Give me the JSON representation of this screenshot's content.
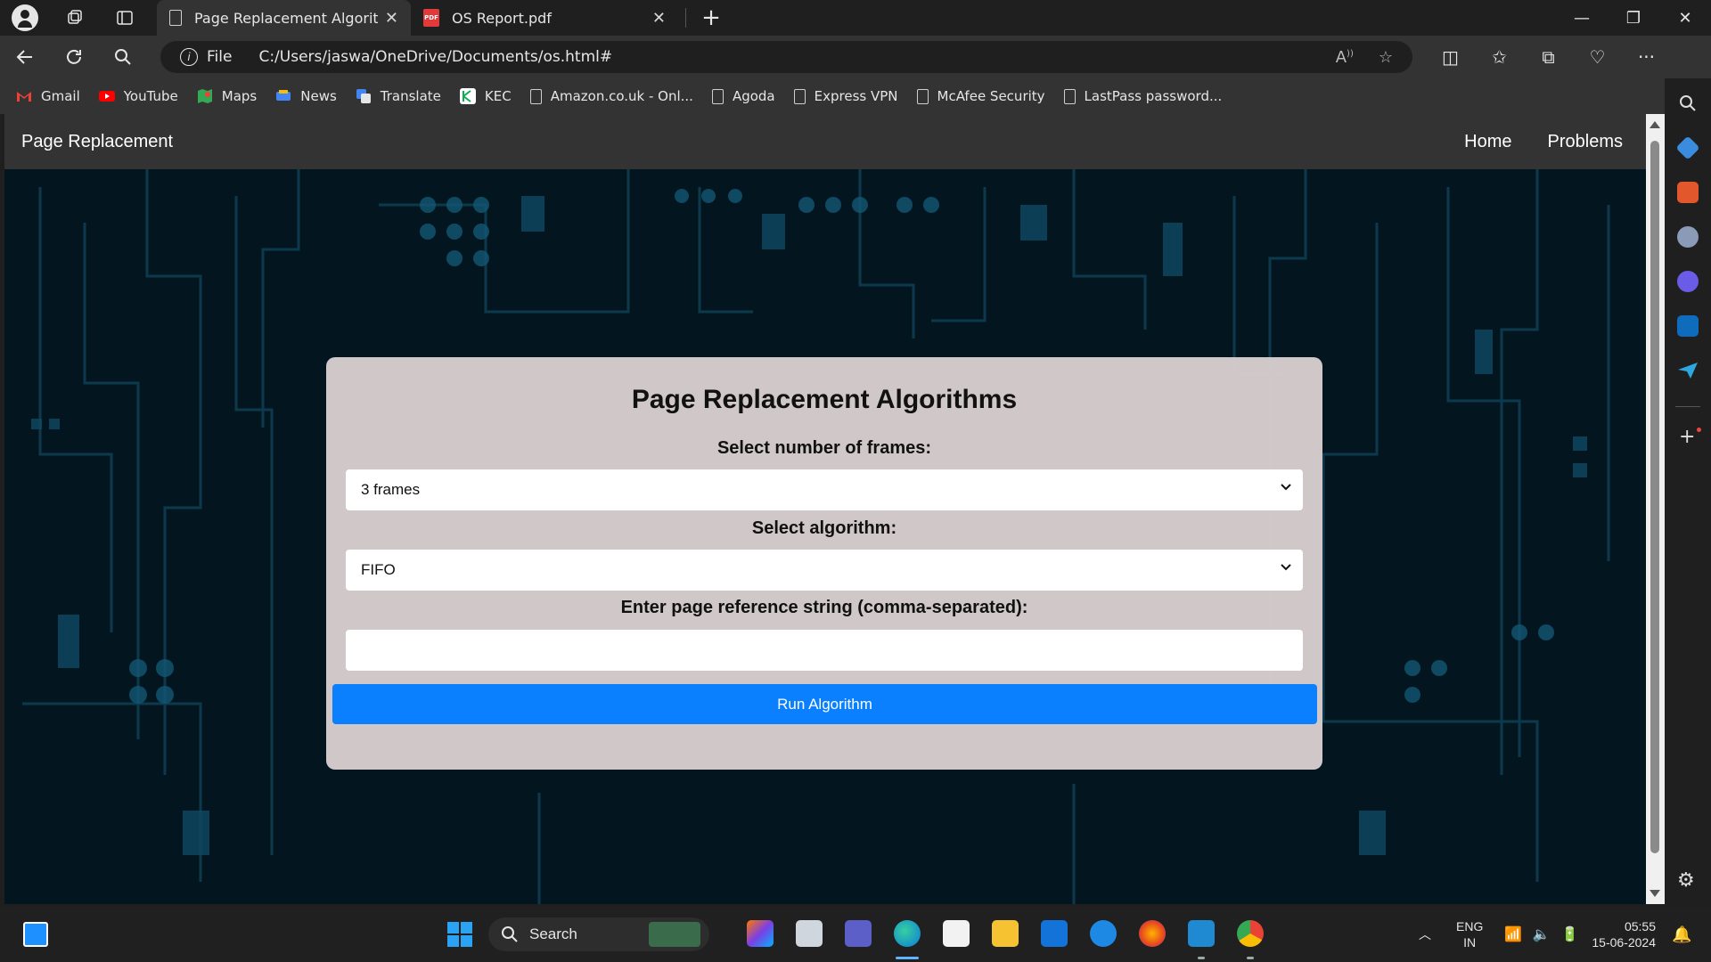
{
  "browser": {
    "tabs": [
      {
        "title": "Page Replacement Algorithms",
        "active": true
      },
      {
        "title": "OS Report.pdf",
        "active": false
      }
    ],
    "address": {
      "scheme_label": "File",
      "url": "C:/Users/jaswa/OneDrive/Documents/os.html#"
    },
    "bookmarks": [
      {
        "label": "Gmail",
        "icon": "gmail-icon",
        "color": "#ea4335"
      },
      {
        "label": "YouTube",
        "icon": "youtube-icon",
        "color": "#ff0000"
      },
      {
        "label": "Maps",
        "icon": "maps-icon",
        "color": "#34a853"
      },
      {
        "label": "News",
        "icon": "news-icon",
        "color": "#4285f4"
      },
      {
        "label": "Translate",
        "icon": "translate-icon",
        "color": "#4285f4"
      },
      {
        "label": "KEC",
        "icon": "kec-icon",
        "color": "#ffffff"
      },
      {
        "label": "Amazon.co.uk - Onl...",
        "icon": "page-icon",
        "color": ""
      },
      {
        "label": "Agoda",
        "icon": "page-icon",
        "color": ""
      },
      {
        "label": "Express VPN",
        "icon": "page-icon",
        "color": ""
      },
      {
        "label": "McAfee Security",
        "icon": "page-icon",
        "color": ""
      },
      {
        "label": "LastPass password...",
        "icon": "page-icon",
        "color": ""
      }
    ]
  },
  "page": {
    "navbar": {
      "brand": "Page Replacement",
      "links": [
        "Home",
        "Problems"
      ]
    },
    "card": {
      "title": "Page Replacement Algorithms",
      "frames_label": "Select number of frames:",
      "frames_value": "3 frames",
      "algorithm_label": "Select algorithm:",
      "algorithm_value": "FIFO",
      "reference_label": "Enter page reference string (comma-separated):",
      "reference_value": "",
      "run_button": "Run Algorithm"
    },
    "colors": {
      "navbar_bg": "#333333",
      "card_bg": "#d6cdcd",
      "button_bg": "#0a80ff",
      "page_bg": "#02141d"
    }
  },
  "taskbar": {
    "search_label": "Search",
    "language": "ENG",
    "region": "IN",
    "time": "05:55",
    "date": "15-06-2024"
  }
}
